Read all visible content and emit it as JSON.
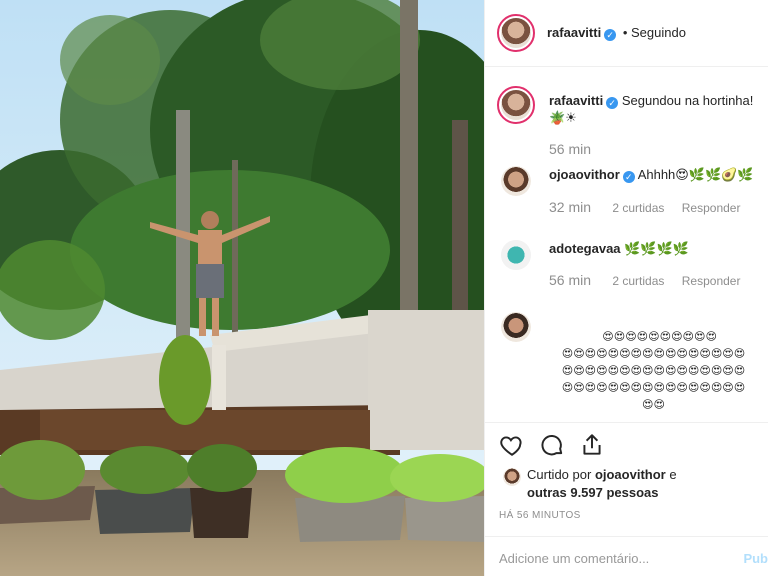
{
  "post": {
    "author": "rafaavitti",
    "follow_status": "• Seguindo"
  },
  "caption": {
    "username": "rafaavitti",
    "text": "Segundou na hortinha! 🪴☀",
    "time": "56 min"
  },
  "comments": [
    {
      "username": "ojoaovithor",
      "verified": true,
      "text": "Ahhhh😍🌿🌿🥑🌿",
      "time": "32 min",
      "likes": "2 curtidas",
      "reply": "Responder"
    },
    {
      "username": "adotegavaa",
      "verified": false,
      "text": "🌿🌿🌿🌿",
      "time": "56 min",
      "likes": "2 curtidas",
      "reply": "Responder"
    },
    {
      "username": "",
      "verified": false,
      "text": "😍😍😍😍😍😍😍😍😍😍\n😍😍😍😍😍😍😍😍😍😍😍😍😍😍😍😍\n😍😍😍😍😍😍😍😍😍😍😍😍😍😍😍😍\n😍😍😍😍😍😍😍😍😍😍😍😍😍😍😍😍\n😍😍"
    }
  ],
  "actions": {
    "like_icon": "heart-icon",
    "comment_icon": "comment-icon",
    "share_icon": "share-icon"
  },
  "likes": {
    "prefix": "Curtido por",
    "user": "ojoaovithor",
    "middle": "e",
    "others": "outras 9.597 pessoas"
  },
  "timestamp": "HÁ 56 MINUTOS",
  "add_comment": {
    "placeholder": "Adicione um comentário...",
    "post_label": "Pub"
  },
  "colors": {
    "verified": "#3897f0",
    "story_ring": "#e1306c",
    "post_button": "#b2dffc"
  }
}
